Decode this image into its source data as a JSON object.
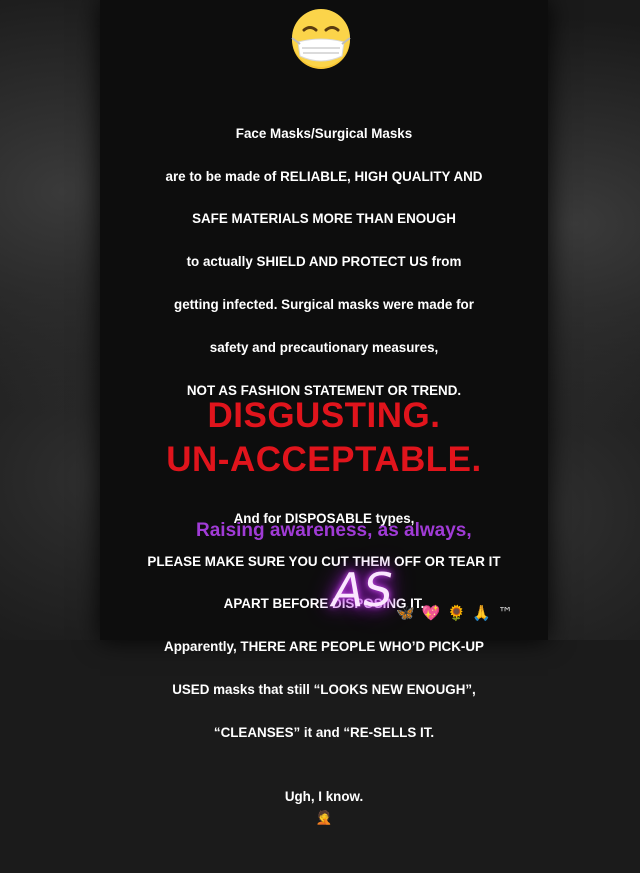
{
  "post": {
    "paragraph1_lines": [
      "Face Masks/Surgical Masks",
      "are to be made of RELIABLE, HIGH QUALITY AND",
      "SAFE MATERIALS MORE THAN ENOUGH",
      "to actually SHIELD AND PROTECT US from",
      "getting infected. Surgical masks were made for",
      "safety and precautionary measures,",
      "NOT AS FASHION STATEMENT OR TREND."
    ],
    "paragraph2_lines": [
      "And for DISPOSABLE types,",
      "PLEASE MAKE SURE YOU CUT THEM OFF OR TEAR IT",
      "APART BEFORE DISPOSING IT.",
      "Apparently, THERE ARE PEOPLE WHO’D PICK-UP",
      "USED masks that still “LOOKS NEW ENOUGH”,",
      "“CLEANSES” it and “RE-SELLS IT.",
      "Ugh, I know."
    ],
    "emphasis_1": "DISGUSTING.",
    "emphasis_2": "UN-ACCEPTABLE.",
    "awareness": "Raising awareness, as always,",
    "signature": "AS",
    "trailing_emojis": [
      "🦋",
      "💖",
      "🌻",
      "🙏"
    ],
    "trademark": "™"
  },
  "icons": {
    "top_emoji": "face-with-medical-mask-icon",
    "facepalm_emoji": "facepalm-icon"
  },
  "colors": {
    "panel_bg": "#0d0d0d",
    "text": "#ffffff",
    "emphasis_red": "#e0141c",
    "awareness_purple": "#a03bd6",
    "signature_glow": "#c63bf0"
  }
}
